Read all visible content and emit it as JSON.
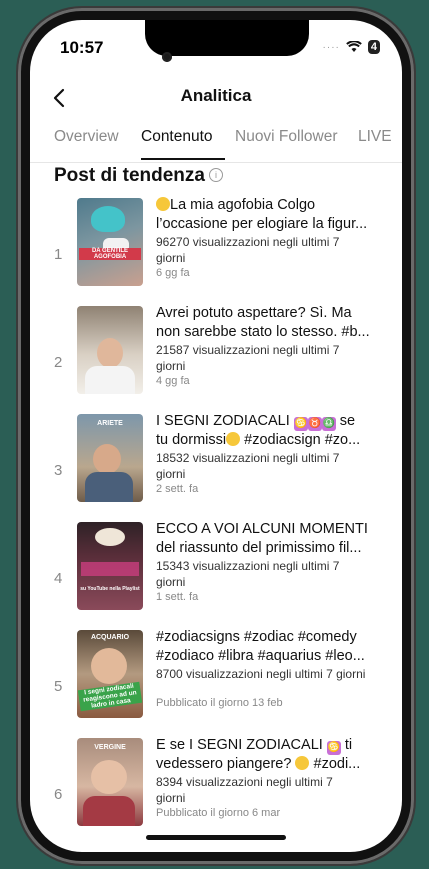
{
  "status_bar": {
    "time": "10:57",
    "battery": "4"
  },
  "header": {
    "title": "Analitica"
  },
  "tabs": [
    {
      "label": "Overview",
      "active": false
    },
    {
      "label": "Contenuto",
      "active": true
    },
    {
      "label": "Nuovi Follower",
      "active": false
    },
    {
      "label": "LIVE",
      "active": false
    }
  ],
  "section": {
    "title": "Post di tendenza"
  },
  "posts": [
    {
      "rank": "1",
      "caption_1": "La mia agofobia Colgo",
      "caption_2": "l’occasione per elogiare la figur...",
      "views": "96270 visualizzazioni negli ultimi 7",
      "views_2": "giorni",
      "date": "6 gg fa",
      "thumb_colors": [
        "#4a6b7a",
        "#c8a79a"
      ]
    },
    {
      "rank": "2",
      "caption_1": "Avrei potuto aspettare? Sì. Ma",
      "caption_2": "non sarebbe stato lo stesso. #b...",
      "views": "21587 visualizzazioni negli ultimi 7",
      "views_2": "giorni",
      "date": "4 gg fa",
      "thumb_colors": [
        "#9a8a7a",
        "#e6ddd2"
      ]
    },
    {
      "rank": "3",
      "caption_1": "I SEGNI ZODIACALI",
      "caption_2": "tu dormissi",
      "caption_2b": "#zodiacsign #zo...",
      "views": "18532 visualizzazioni negli ultimi 7",
      "views_2": "giorni",
      "date": "2 sett. fa",
      "thumb_colors": [
        "#6e8aa0",
        "#b9a78e"
      ]
    },
    {
      "rank": "4",
      "caption_1": "ECCO A VOI ALCUNI MOMENTI",
      "caption_2": "del riassunto del primissimo fil...",
      "views": "15343 visualizzazioni negli ultimi 7",
      "views_2": "giorni",
      "date": "1 sett. fa",
      "thumb_colors": [
        "#3a2a2e",
        "#8a4a5a"
      ]
    },
    {
      "rank": "5",
      "caption_1": "#zodiacsigns #zodiac #comedy",
      "caption_2": "#zodiaco #libra #aquarius #leo...",
      "views": "8700 visualizzazioni negli ultimi 7 giorni",
      "views_2": "",
      "date": "Pubblicato il giorno 13 feb",
      "thumb_colors": [
        "#5a4a3a",
        "#d6b89a"
      ]
    },
    {
      "rank": "6",
      "caption_1": "E se I SEGNI ZODIACALI",
      "caption_2": "vedessero piangere?",
      "caption_2b": "#zodi...",
      "views": "8394 visualizzazioni negli ultimi 7",
      "views_2": "giorni",
      "date": "Pubblicato il giorno 6 mar",
      "thumb_colors": [
        "#b89a8a",
        "#e8c9b6"
      ]
    }
  ],
  "thumb_texts": {
    "t1": "DA GENTILE AGOFOBIA",
    "t3": "ARIETE",
    "t4": "su YouTube nella Playlist",
    "t5_top": "ACQUARIO",
    "t5_mid": "I segni zodiacali reagiscono ad un ladro in casa",
    "t6": "VERGINE"
  },
  "zodiac_glyphs": {
    "g1": "♋",
    "g2": "♉",
    "g3": "♎",
    "g4": "♋"
  },
  "colors": {
    "accent": "#111111",
    "muted": "#888888",
    "background": "#2b5e55"
  }
}
